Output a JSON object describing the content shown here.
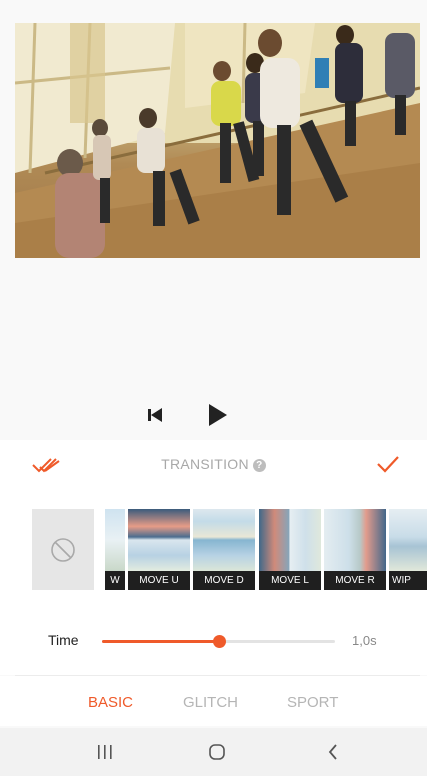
{
  "colors": {
    "accent": "#ef5a2a",
    "tab_inactive": "#b5b5b5",
    "title_gray": "#a8a8a8"
  },
  "icons": {
    "apply_all": "double-check-icon",
    "confirm": "check-icon",
    "help": "help-circle-icon",
    "prev": "skip-previous-icon",
    "play": "play-icon",
    "none": "no-transition-icon",
    "nav_recents": "recent-apps-icon",
    "nav_home": "home-icon",
    "nav_back": "back-icon"
  },
  "transition": {
    "title": "TRANSITION",
    "help_glyph": "?",
    "tiles": [
      {
        "label": "W"
      },
      {
        "label": "MOVE U"
      },
      {
        "label": "MOVE D"
      },
      {
        "label": "MOVE L"
      },
      {
        "label": "MOVE R"
      },
      {
        "label": "WIP"
      }
    ]
  },
  "time": {
    "label": "Time",
    "value": "1,0s",
    "slider_fraction": 0.5
  },
  "tabs": [
    {
      "label": "BASIC",
      "active": true
    },
    {
      "label": "GLITCH",
      "active": false
    },
    {
      "label": "SPORT",
      "active": false
    }
  ]
}
